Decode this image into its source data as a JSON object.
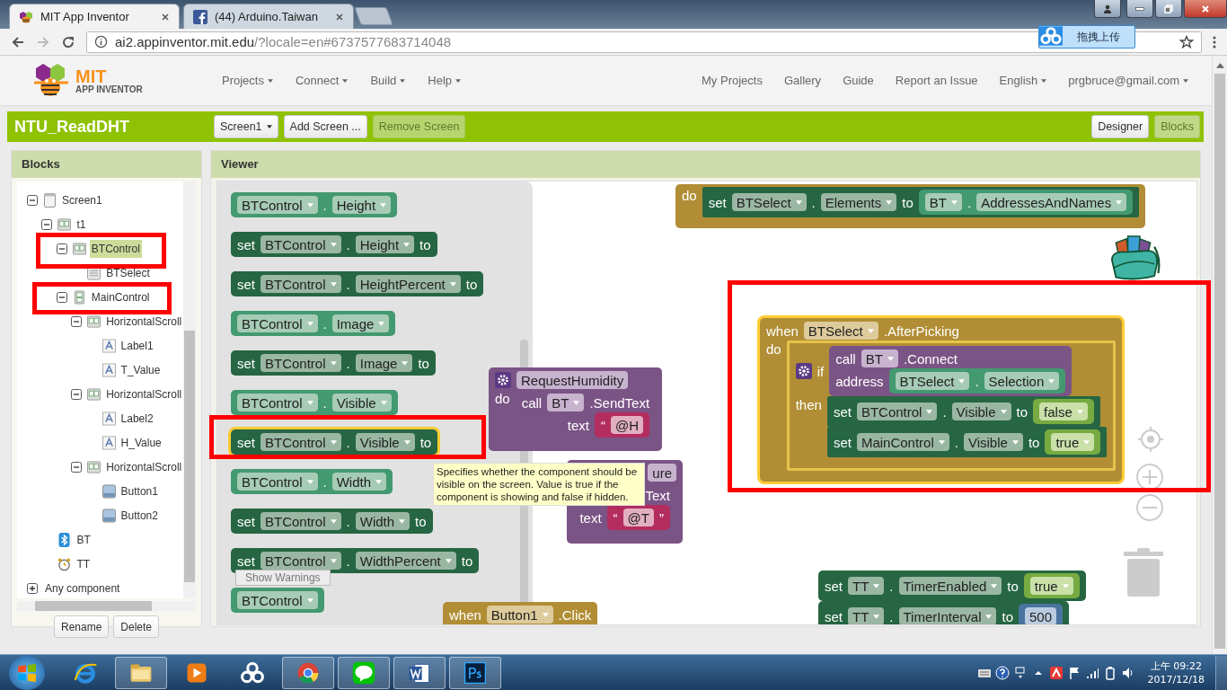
{
  "browser": {
    "tabs": [
      {
        "title": "MIT App Inventor",
        "kind": "bee",
        "selected": true
      },
      {
        "title": "(44) Arduino.Taiwan",
        "kind": "facebook",
        "selected": false
      }
    ],
    "url_host": "ai2.appinventor.mit.edu",
    "url_path": "/?locale=en#6737577683714048",
    "upload_button": "拖拽上传"
  },
  "header": {
    "logo_top": "MIT",
    "logo_bottom": "APP INVENTOR",
    "menus": [
      {
        "label": "Projects",
        "dropdown": true
      },
      {
        "label": "Connect",
        "dropdown": true
      },
      {
        "label": "Build",
        "dropdown": true
      },
      {
        "label": "Help",
        "dropdown": true
      }
    ],
    "links": [
      {
        "label": "My Projects",
        "dropdown": false
      },
      {
        "label": "Gallery",
        "dropdown": false
      },
      {
        "label": "Guide",
        "dropdown": false
      },
      {
        "label": "Report an Issue",
        "dropdown": false
      },
      {
        "label": "English",
        "dropdown": true
      },
      {
        "label": "prgbruce@gmail.com",
        "dropdown": true
      }
    ]
  },
  "toolbar": {
    "project": "NTU_ReadDHT",
    "buttons": [
      {
        "label": "Screen1",
        "dropdown": true,
        "disabled": false
      },
      {
        "label": "Add Screen ...",
        "dropdown": false,
        "disabled": false
      },
      {
        "label": "Remove Screen",
        "dropdown": false,
        "disabled": true
      }
    ],
    "views": [
      {
        "label": "Designer",
        "selected": false
      },
      {
        "label": "Blocks",
        "selected": true
      }
    ]
  },
  "blocks_panel": {
    "title": "Blocks",
    "tree": [
      {
        "label": "Screen1",
        "kind": "screen",
        "expanded": true,
        "selected": false,
        "children": [
          {
            "label": "t1",
            "kind": "horizontal",
            "expanded": true,
            "selected": false,
            "children": [
              {
                "label": "BTControl",
                "kind": "horizontal",
                "expanded": true,
                "selected": true,
                "children": [
                  {
                    "label": "BTSelect",
                    "kind": "picker",
                    "selected": false
                  }
                ]
              },
              {
                "label": "MainControl",
                "kind": "vertical",
                "expanded": true,
                "selected": false,
                "children": [
                  {
                    "label": "HorizontalScroll",
                    "kind": "horizontal",
                    "expanded": true,
                    "selected": false,
                    "children": [
                      {
                        "label": "Label1",
                        "kind": "label",
                        "selected": false
                      },
                      {
                        "label": "T_Value",
                        "kind": "label",
                        "selected": false
                      }
                    ]
                  },
                  {
                    "label": "HorizontalScroll",
                    "kind": "horizontal",
                    "expanded": true,
                    "selected": false,
                    "children": [
                      {
                        "label": "Label2",
                        "kind": "label",
                        "selected": false
                      },
                      {
                        "label": "H_Value",
                        "kind": "label",
                        "selected": false
                      }
                    ]
                  },
                  {
                    "label": "HorizontalScroll",
                    "kind": "horizontal",
                    "expanded": true,
                    "selected": false,
                    "children": [
                      {
                        "label": "Button1",
                        "kind": "button",
                        "selected": false
                      },
                      {
                        "label": "Button2",
                        "kind": "button",
                        "selected": false
                      }
                    ]
                  }
                ]
              }
            ]
          },
          {
            "label": "BT",
            "kind": "bluetooth",
            "selected": false
          },
          {
            "label": "TT",
            "kind": "clock",
            "selected": false
          }
        ]
      },
      {
        "label": "Any component",
        "kind": "none",
        "expanded": false,
        "selected": false
      }
    ],
    "buttons": [
      "Rename",
      "Delete"
    ]
  },
  "viewer": {
    "title": "Viewer",
    "show_warnings": "Show Warnings",
    "tooltip": "Specifies whether the component should be visible on the screen. Value is true if the component is showing and false if hidden.",
    "flyout": [
      {
        "kind": "getter",
        "selected": false,
        "rows": [
          {
            "parts": [
              {
                "kind": "field",
                "text": "BTControl",
                "dropdown": true
              },
              {
                "kind": "label",
                "text": "."
              },
              {
                "kind": "field",
                "text": "Height",
                "dropdown": true
              }
            ]
          }
        ]
      },
      {
        "kind": "setter",
        "selected": false,
        "rows": [
          {
            "parts": [
              {
                "kind": "label",
                "text": "set"
              },
              {
                "kind": "field",
                "text": "BTControl",
                "dropdown": true
              },
              {
                "kind": "label",
                "text": "."
              },
              {
                "kind": "field",
                "text": "Height",
                "dropdown": true
              },
              {
                "kind": "label",
                "text": "to"
              }
            ]
          }
        ]
      },
      {
        "kind": "setter",
        "selected": false,
        "rows": [
          {
            "parts": [
              {
                "kind": "label",
                "text": "set"
              },
              {
                "kind": "field",
                "text": "BTControl",
                "dropdown": true
              },
              {
                "kind": "label",
                "text": "."
              },
              {
                "kind": "field",
                "text": "HeightPercent",
                "dropdown": true
              },
              {
                "kind": "label",
                "text": "to"
              }
            ]
          }
        ]
      },
      {
        "kind": "getter",
        "selected": false,
        "rows": [
          {
            "parts": [
              {
                "kind": "field",
                "text": "BTControl",
                "dropdown": true
              },
              {
                "kind": "label",
                "text": "."
              },
              {
                "kind": "field",
                "text": "Image",
                "dropdown": true
              }
            ]
          }
        ]
      },
      {
        "kind": "setter",
        "selected": false,
        "rows": [
          {
            "parts": [
              {
                "kind": "label",
                "text": "set"
              },
              {
                "kind": "field",
                "text": "BTControl",
                "dropdown": true
              },
              {
                "kind": "label",
                "text": "."
              },
              {
                "kind": "field",
                "text": "Image",
                "dropdown": true
              },
              {
                "kind": "label",
                "text": "to"
              }
            ]
          }
        ]
      },
      {
        "kind": "getter",
        "selected": false,
        "rows": [
          {
            "parts": [
              {
                "kind": "field",
                "text": "BTControl",
                "dropdown": true
              },
              {
                "kind": "label",
                "text": "."
              },
              {
                "kind": "field",
                "text": "Visible",
                "dropdown": true
              }
            ]
          }
        ]
      },
      {
        "kind": "setter",
        "selected": true,
        "rows": [
          {
            "parts": [
              {
                "kind": "label",
                "text": "set"
              },
              {
                "kind": "field",
                "text": "BTControl",
                "dropdown": true
              },
              {
                "kind": "label",
                "text": "."
              },
              {
                "kind": "field",
                "text": "Visible",
                "dropdown": true
              },
              {
                "kind": "label",
                "text": "to"
              }
            ]
          }
        ]
      },
      {
        "kind": "getter",
        "selected": false,
        "rows": [
          {
            "parts": [
              {
                "kind": "field",
                "text": "BTControl",
                "dropdown": true
              },
              {
                "kind": "label",
                "text": "."
              },
              {
                "kind": "field",
                "text": "Width",
                "dropdown": true
              }
            ]
          }
        ]
      },
      {
        "kind": "setter",
        "selected": false,
        "rows": [
          {
            "parts": [
              {
                "kind": "label",
                "text": "set"
              },
              {
                "kind": "field",
                "text": "BTControl",
                "dropdown": true
              },
              {
                "kind": "label",
                "text": "."
              },
              {
                "kind": "field",
                "text": "Width",
                "dropdown": true
              },
              {
                "kind": "label",
                "text": "to"
              }
            ]
          }
        ]
      },
      {
        "kind": "setter",
        "selected": false,
        "rows": [
          {
            "parts": [
              {
                "kind": "label",
                "text": "set"
              },
              {
                "kind": "field",
                "text": "BTControl",
                "dropdown": true
              },
              {
                "kind": "label",
                "text": "."
              },
              {
                "kind": "field",
                "text": "WidthPercent",
                "dropdown": true
              },
              {
                "kind": "label",
                "text": "to"
              }
            ]
          }
        ]
      },
      {
        "kind": "getter",
        "selected": false,
        "rows": [
          {
            "parts": [
              {
                "kind": "field",
                "text": "BTControl",
                "dropdown": true
              }
            ]
          }
        ]
      }
    ],
    "workspace": [
      {
        "blocks": [
          {
            "kind": "event",
            "selected": false,
            "rows": [
              {
                "parts": [
                  {
                    "kind": "label",
                    "text": "do"
                  },
                  {
                    "kind": "statements",
                    "blocks": [
                      {
                        "kind": "setter",
                        "rows": [
                          {
                            "parts": [
                              {
                                "kind": "label",
                                "text": "set"
                              },
                              {
                                "kind": "field",
                                "text": "BTSelect",
                                "dropdown": true
                              },
                              {
                                "kind": "label",
                                "text": "."
                              },
                              {
                                "kind": "field",
                                "text": "Elements",
                                "dropdown": true
                              },
                              {
                                "kind": "label",
                                "text": "to"
                              },
                              {
                                "kind": "input",
                                "block": {
                                  "kind": "getter",
                                  "rows": [
                                    {
                                      "parts": [
                                        {
                                          "kind": "field",
                                          "text": "BT",
                                          "dropdown": true
                                        },
                                        {
                                          "kind": "label",
                                          "text": "."
                                        },
                                        {
                                          "kind": "field",
                                          "text": "AddressesAndNames",
                                          "dropdown": true
                                        }
                                      ]
                                    }
                                  ]
                                }
                              }
                            ]
                          }
                        ]
                      }
                    ]
                  }
                ]
              }
            ]
          }
        ]
      },
      {
        "blocks": [
          {
            "kind": "procedure",
            "selected": false,
            "rows": [
              {
                "parts": [
                  {
                    "kind": "mutator"
                  },
                  {
                    "kind": "field",
                    "text": "RequestHumidity",
                    "dropdown": false
                  }
                ]
              },
              {
                "parts": [
                  {
                    "kind": "label",
                    "text": "do"
                  },
                  {
                    "kind": "statements",
                    "blocks": [
                      {
                        "kind": "call",
                        "rows": [
                          {
                            "parts": [
                              {
                                "kind": "label",
                                "text": "call"
                              },
                              {
                                "kind": "field",
                                "text": "BT",
                                "dropdown": true
                              },
                              {
                                "kind": "label",
                                "text": ".SendText"
                              }
                            ]
                          },
                          {
                            "parts": [
                              {
                                "kind": "label",
                                "text": "text"
                              },
                              {
                                "kind": "input",
                                "block": {
                                  "kind": "text",
                                  "rows": [
                                    {
                                      "parts": [
                                        {
                                          "kind": "label",
                                          "text": "“"
                                        },
                                        {
                                          "kind": "field",
                                          "text": "@H",
                                          "dropdown": false
                                        }
                                      ]
                                    }
                                  ]
                                }
                              }
                            ]
                          }
                        ]
                      }
                    ]
                  }
                ]
              }
            ]
          }
        ]
      },
      {
        "blocks": [
          {
            "kind": "procedure",
            "selected": false,
            "rows": [
              {
                "parts": [
                  {
                    "kind": "field",
                    "text": "ure",
                    "dropdown": false
                  }
                ]
              },
              {
                "parts": [
                  {
                    "kind": "statements",
                    "blocks": [
                      {
                        "kind": "call",
                        "rows": [
                          {
                            "parts": [
                              {
                                "kind": "label",
                                "text": "Text"
                              }
                            ]
                          },
                          {
                            "parts": [
                              {
                                "kind": "label",
                                "text": "text"
                              },
                              {
                                "kind": "input",
                                "block": {
                                  "kind": "text",
                                  "rows": [
                                    {
                                      "parts": [
                                        {
                                          "kind": "label",
                                          "text": "“"
                                        },
                                        {
                                          "kind": "field",
                                          "text": "@T",
                                          "dropdown": false
                                        },
                                        {
                                          "kind": "label",
                                          "text": "”"
                                        }
                                      ]
                                    }
                                  ]
                                }
                              }
                            ]
                          }
                        ]
                      }
                    ]
                  }
                ]
              }
            ]
          }
        ]
      },
      {
        "blocks": [
          {
            "kind": "event",
            "selected": true,
            "rows": [
              {
                "parts": [
                  {
                    "kind": "label",
                    "text": "when"
                  },
                  {
                    "kind": "field",
                    "text": "BTSelect",
                    "dropdown": true
                  },
                  {
                    "kind": "label",
                    "text": ".AfterPicking"
                  }
                ]
              },
              {
                "parts": [
                  {
                    "kind": "label",
                    "text": "do"
                  },
                  {
                    "kind": "statements",
                    "blocks": [
                      {
                        "kind": "control",
                        "rows": [
                          {
                            "parts": [
                              {
                                "kind": "mutator"
                              },
                              {
                                "kind": "label",
                                "text": "if"
                              },
                              {
                                "kind": "input",
                                "block": {
                                  "kind": "call",
                                  "rows": [
                                    {
                                      "parts": [
                                        {
                                          "kind": "label",
                                          "text": "call"
                                        },
                                        {
                                          "kind": "field",
                                          "text": "BT",
                                          "dropdown": true
                                        },
                                        {
                                          "kind": "label",
                                          "text": ".Connect"
                                        }
                                      ]
                                    },
                                    {
                                      "parts": [
                                        {
                                          "kind": "label",
                                          "text": "address"
                                        },
                                        {
                                          "kind": "input",
                                          "block": {
                                            "kind": "getter",
                                            "rows": [
                                              {
                                                "parts": [
                                                  {
                                                    "kind": "field",
                                                    "text": "BTSelect",
                                                    "dropdown": true
                                                  },
                                                  {
                                                    "kind": "label",
                                                    "text": "."
                                                  },
                                                  {
                                                    "kind": "field",
                                                    "text": "Selection",
                                                    "dropdown": true
                                                  }
                                                ]
                                              }
                                            ]
                                          }
                                        }
                                      ]
                                    }
                                  ]
                                }
                              }
                            ]
                          },
                          {
                            "parts": [
                              {
                                "kind": "label",
                                "text": "then"
                              },
                              {
                                "kind": "statements",
                                "blocks": [
                                  {
                                    "kind": "setter",
                                    "rows": [
                                      {
                                        "parts": [
                                          {
                                            "kind": "label",
                                            "text": "set"
                                          },
                                          {
                                            "kind": "field",
                                            "text": "BTControl",
                                            "dropdown": true
                                          },
                                          {
                                            "kind": "label",
                                            "text": "."
                                          },
                                          {
                                            "kind": "field",
                                            "text": "Visible",
                                            "dropdown": true
                                          },
                                          {
                                            "kind": "label",
                                            "text": "to"
                                          },
                                          {
                                            "kind": "input",
                                            "block": {
                                              "kind": "logic",
                                              "rows": [
                                                {
                                                  "parts": [
                                                    {
                                                      "kind": "field",
                                                      "text": "false",
                                                      "dropdown": true
                                                    }
                                                  ]
                                                }
                                              ]
                                            }
                                          }
                                        ]
                                      }
                                    ]
                                  },
                                  {
                                    "kind": "setter",
                                    "rows": [
                                      {
                                        "parts": [
                                          {
                                            "kind": "label",
                                            "text": "set"
                                          },
                                          {
                                            "kind": "field",
                                            "text": "MainControl",
                                            "dropdown": true
                                          },
                                          {
                                            "kind": "label",
                                            "text": "."
                                          },
                                          {
                                            "kind": "field",
                                            "text": "Visible",
                                            "dropdown": true
                                          },
                                          {
                                            "kind": "label",
                                            "text": "to"
                                          },
                                          {
                                            "kind": "input",
                                            "block": {
                                              "kind": "logic",
                                              "rows": [
                                                {
                                                  "parts": [
                                                    {
                                                      "kind": "field",
                                                      "text": "true",
                                                      "dropdown": true
                                                    }
                                                  ]
                                                }
                                              ]
                                            }
                                          }
                                        ]
                                      }
                                    ]
                                  }
                                ]
                              }
                            ]
                          }
                        ]
                      }
                    ]
                  }
                ]
              }
            ]
          }
        ]
      },
      {
        "blocks": [
          {
            "kind": "event",
            "selected": false,
            "rows": [
              {
                "parts": [
                  {
                    "kind": "label",
                    "text": "when"
                  },
                  {
                    "kind": "field",
                    "text": "Button1",
                    "dropdown": true
                  },
                  {
                    "kind": "label",
                    "text": ".Click"
                  }
                ]
              }
            ]
          }
        ]
      },
      {
        "blocks": [
          {
            "kind": "setter",
            "selected": false,
            "rows": [
              {
                "parts": [
                  {
                    "kind": "label",
                    "text": "set"
                  },
                  {
                    "kind": "field",
                    "text": "TT",
                    "dropdown": true
                  },
                  {
                    "kind": "label",
                    "text": "."
                  },
                  {
                    "kind": "field",
                    "text": "TimerEnabled",
                    "dropdown": true
                  },
                  {
                    "kind": "label",
                    "text": "to"
                  },
                  {
                    "kind": "input",
                    "block": {
                      "kind": "logic",
                      "rows": [
                        {
                          "parts": [
                            {
                              "kind": "field",
                              "text": "true",
                              "dropdown": true
                            }
                          ]
                        }
                      ]
                    }
                  }
                ]
              }
            ]
          },
          {
            "kind": "setter",
            "selected": false,
            "rows": [
              {
                "parts": [
                  {
                    "kind": "label",
                    "text": "set"
                  },
                  {
                    "kind": "field",
                    "text": "TT",
                    "dropdown": true
                  },
                  {
                    "kind": "label",
                    "text": "."
                  },
                  {
                    "kind": "field",
                    "text": "TimerInterval",
                    "dropdown": true
                  },
                  {
                    "kind": "label",
                    "text": "to"
                  },
                  {
                    "kind": "input",
                    "block": {
                      "kind": "number",
                      "rows": [
                        {
                          "parts": [
                            {
                              "kind": "field",
                              "text": "500",
                              "dropdown": false
                            }
                          ]
                        }
                      ]
                    }
                  }
                ]
              }
            ]
          }
        ]
      }
    ]
  },
  "taskbar": {
    "apps": [
      {
        "kind": "ie",
        "running": false
      },
      {
        "kind": "explorer",
        "running": true
      },
      {
        "kind": "media",
        "running": false
      },
      {
        "kind": "cloud",
        "running": false
      },
      {
        "kind": "chrome",
        "running": true
      },
      {
        "kind": "line",
        "running": true
      },
      {
        "kind": "word",
        "running": true
      },
      {
        "kind": "photoshop",
        "running": true
      }
    ],
    "time": "上午 09:22",
    "date": "2017/12/18"
  }
}
